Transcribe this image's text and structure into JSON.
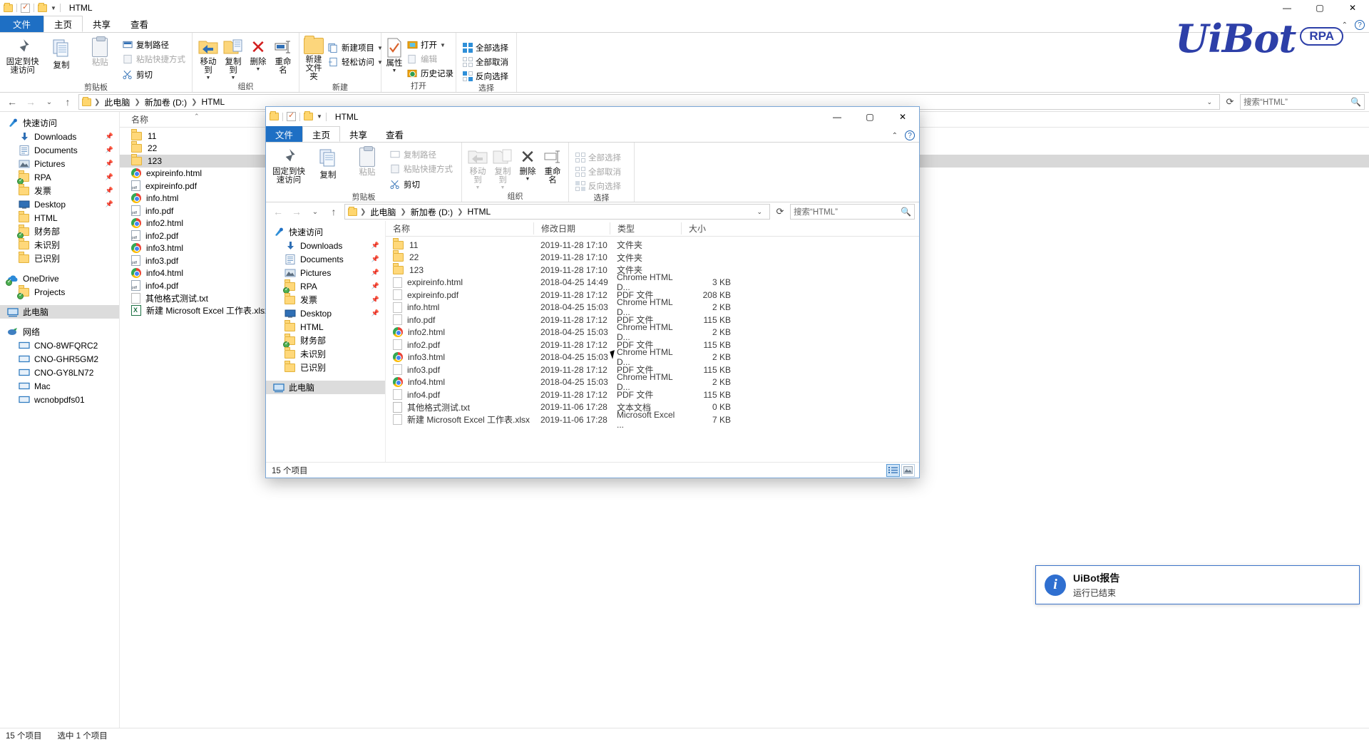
{
  "outer_window": {
    "title": "HTML",
    "quick_access_icons": [
      "folder-icon",
      "check-document-icon",
      "folder-icon",
      "chevron-down-icon"
    ],
    "window_controls": {
      "minimize": "—",
      "maximize": "▢",
      "close": "✕"
    },
    "tabs": [
      {
        "label": "文件",
        "active": false,
        "is_file_tab": true
      },
      {
        "label": "主页",
        "active": true
      },
      {
        "label": "共享",
        "active": false
      },
      {
        "label": "查看",
        "active": false
      }
    ],
    "ribbon": {
      "groups": [
        {
          "title": "剪贴板",
          "big_buttons": [
            {
              "label": "固定到快\n速访问",
              "icon": "pin-icon",
              "line1": "固定到快",
              "line2": "速访问"
            },
            {
              "label": "复制",
              "icon": "copy-icon"
            },
            {
              "label": "粘贴",
              "icon": "paste-icon",
              "dim": true
            }
          ],
          "small_buttons": [
            {
              "label": "复制路径",
              "icon": "copy-path-icon",
              "dim": false
            },
            {
              "label": "粘贴快捷方式",
              "icon": "paste-shortcut-icon",
              "dim": true
            },
            {
              "label": "剪切",
              "icon": "scissors-icon",
              "dim": false
            }
          ]
        },
        {
          "title": "组织",
          "big_buttons": [
            {
              "label": "移动到",
              "icon": "move-to-icon",
              "has_dropdown": true
            },
            {
              "label": "复制到",
              "icon": "copy-to-icon",
              "has_dropdown": true
            },
            {
              "label": "删除",
              "icon": "delete-icon",
              "has_dropdown": true
            },
            {
              "label": "重命名",
              "icon": "rename-icon"
            }
          ]
        },
        {
          "title": "新建",
          "big_buttons": [
            {
              "label": "新建\n文件夹",
              "icon": "new-folder-icon",
              "line1": "新建",
              "line2": "文件夹"
            }
          ],
          "small_buttons": [
            {
              "label": "新建项目",
              "icon": "new-item-icon",
              "has_dropdown": true
            },
            {
              "label": "轻松访问",
              "icon": "easy-access-icon",
              "has_dropdown": true
            }
          ]
        },
        {
          "title": "打开",
          "big_buttons": [
            {
              "label": "属性",
              "icon": "properties-icon",
              "has_dropdown": true
            }
          ],
          "small_buttons": [
            {
              "label": "打开",
              "icon": "open-icon",
              "has_dropdown": true
            },
            {
              "label": "编辑",
              "icon": "edit-icon",
              "dim": true
            },
            {
              "label": "历史记录",
              "icon": "history-icon"
            }
          ]
        },
        {
          "title": "选择",
          "small_buttons": [
            {
              "label": "全部选择",
              "icon": "select-all-icon"
            },
            {
              "label": "全部取消",
              "icon": "select-none-icon"
            },
            {
              "label": "反向选择",
              "icon": "invert-selection-icon"
            }
          ]
        }
      ]
    },
    "addressbar": {
      "back": "←",
      "forward": "→",
      "recent": "⌄",
      "up": "↑",
      "crumbs": [
        "此电脑",
        "新加卷 (D:)",
        "HTML"
      ],
      "search_value": "搜索“HTML”",
      "refresh_icon": "refresh-icon"
    },
    "navpane": [
      {
        "label": "快速访问",
        "icon": "star-pin-icon",
        "indent": 0,
        "pinned": false
      },
      {
        "label": "Downloads",
        "icon": "download-icon",
        "indent": 1,
        "pinned": true
      },
      {
        "label": "Documents",
        "icon": "documents-icon",
        "indent": 1,
        "pinned": true
      },
      {
        "label": "Pictures",
        "icon": "pictures-icon",
        "indent": 1,
        "pinned": true
      },
      {
        "label": "RPA",
        "icon": "folder-sync-icon",
        "indent": 1,
        "pinned": true
      },
      {
        "label": "发票",
        "icon": "folder-icon",
        "indent": 1,
        "pinned": true
      },
      {
        "label": "Desktop",
        "icon": "desktop-icon",
        "indent": 1,
        "pinned": true
      },
      {
        "label": "HTML",
        "icon": "folder-icon",
        "indent": 1,
        "pinned": false
      },
      {
        "label": "财务部",
        "icon": "folder-sync-icon",
        "indent": 1,
        "pinned": false
      },
      {
        "label": "未识别",
        "icon": "folder-icon",
        "indent": 1,
        "pinned": false
      },
      {
        "label": "已识别",
        "icon": "folder-icon",
        "indent": 1,
        "pinned": false
      },
      {
        "label": "OneDrive",
        "icon": "onedrive-icon",
        "indent": 0,
        "pinned": false,
        "gap_before": true
      },
      {
        "label": "Projects",
        "icon": "folder-sync-icon",
        "indent": 1,
        "pinned": false
      },
      {
        "label": "此电脑",
        "icon": "this-pc-icon",
        "indent": 0,
        "pinned": false,
        "selected": true,
        "gap_before": true
      },
      {
        "label": "网络",
        "icon": "network-icon",
        "indent": 0,
        "pinned": false,
        "gap_before": true
      },
      {
        "label": "CNO-8WFQRC2",
        "icon": "pc-icon",
        "indent": 1,
        "pinned": false
      },
      {
        "label": "CNO-GHR5GM2",
        "icon": "pc-icon",
        "indent": 1,
        "pinned": false
      },
      {
        "label": "CNO-GY8LN72",
        "icon": "pc-icon",
        "indent": 1,
        "pinned": false
      },
      {
        "label": "Mac",
        "icon": "pc-icon",
        "indent": 1,
        "pinned": false
      },
      {
        "label": "wcnobpdfs01",
        "icon": "pc-icon",
        "indent": 1,
        "pinned": false
      }
    ],
    "column_header": {
      "name": "名称"
    },
    "files": [
      {
        "name": "11",
        "icon": "folder-icon"
      },
      {
        "name": "22",
        "icon": "folder-icon"
      },
      {
        "name": "123",
        "icon": "folder-icon",
        "selected": true
      },
      {
        "name": "expireinfo.html",
        "icon": "chrome-icon"
      },
      {
        "name": "expireinfo.pdf",
        "icon": "pdf-icon"
      },
      {
        "name": "info.html",
        "icon": "chrome-icon"
      },
      {
        "name": "info.pdf",
        "icon": "pdf-icon"
      },
      {
        "name": "info2.html",
        "icon": "chrome-icon"
      },
      {
        "name": "info2.pdf",
        "icon": "pdf-icon"
      },
      {
        "name": "info3.html",
        "icon": "chrome-icon"
      },
      {
        "name": "info3.pdf",
        "icon": "pdf-icon"
      },
      {
        "name": "info4.html",
        "icon": "chrome-icon"
      },
      {
        "name": "info4.pdf",
        "icon": "pdf-icon"
      },
      {
        "name": "其他格式测试.txt",
        "icon": "text-icon"
      },
      {
        "name": "新建 Microsoft Excel 工作表.xlsx",
        "icon": "excel-icon"
      }
    ],
    "statusbar": {
      "count": "15 个项目",
      "selection": "选中 1 个项目"
    }
  },
  "watermark": {
    "text": "UiBot",
    "badge": "RPA",
    "color": "#2d3fa8"
  },
  "inner_window": {
    "title": "HTML",
    "window_controls": {
      "minimize": "—",
      "maximize": "▢",
      "close": "✕"
    },
    "tabs": [
      {
        "label": "文件",
        "is_file_tab": true
      },
      {
        "label": "主页",
        "active": true
      },
      {
        "label": "共享"
      },
      {
        "label": "查看"
      }
    ],
    "ribbon": {
      "groups": [
        {
          "title": "剪贴板",
          "big_buttons": [
            {
              "line1": "固定到快",
              "line2": "速访问",
              "icon": "pin-icon"
            },
            {
              "label": "复制",
              "icon": "copy-icon"
            },
            {
              "label": "粘贴",
              "icon": "paste-icon",
              "dim": true
            }
          ],
          "small_buttons": [
            {
              "label": "复制路径",
              "icon": "copy-path-icon"
            },
            {
              "label": "粘贴快捷方式",
              "icon": "paste-shortcut-icon",
              "dim": true
            },
            {
              "label": "剪切",
              "icon": "scissors-icon"
            }
          ]
        },
        {
          "title": "组织",
          "big_buttons": [
            {
              "label": "移动到",
              "icon": "move-to-icon",
              "dim": true,
              "has_dropdown": true
            },
            {
              "label": "复制到",
              "icon": "copy-to-icon",
              "dim": true,
              "has_dropdown": true
            },
            {
              "label": "删除",
              "icon": "delete-icon",
              "has_dropdown": true
            },
            {
              "label": "重命名",
              "icon": "rename-icon"
            }
          ]
        },
        {
          "title": "选择",
          "small_buttons": [
            {
              "label": "全部选择",
              "icon": "select-all-icon",
              "dim": true
            },
            {
              "label": "全部取消",
              "icon": "select-none-icon",
              "dim": true
            },
            {
              "label": "反向选择",
              "icon": "invert-selection-icon",
              "dim": true
            }
          ]
        }
      ]
    },
    "addressbar": {
      "back": "←",
      "forward": "→",
      "recent": "⌄",
      "up": "↑",
      "crumbs": [
        "此电脑",
        "新加卷 (D:)",
        "HTML"
      ],
      "search_value": "搜索“HTML”"
    },
    "navpane": [
      {
        "label": "快速访问",
        "icon": "star-pin-icon",
        "indent": 0
      },
      {
        "label": "Downloads",
        "icon": "download-icon",
        "indent": 1,
        "pinned": true
      },
      {
        "label": "Documents",
        "icon": "documents-icon",
        "indent": 1,
        "pinned": true
      },
      {
        "label": "Pictures",
        "icon": "pictures-icon",
        "indent": 1,
        "pinned": true
      },
      {
        "label": "RPA",
        "icon": "folder-sync-icon",
        "indent": 1,
        "pinned": true
      },
      {
        "label": "发票",
        "icon": "folder-icon",
        "indent": 1,
        "pinned": true
      },
      {
        "label": "Desktop",
        "icon": "desktop-icon",
        "indent": 1,
        "pinned": true
      },
      {
        "label": "HTML",
        "icon": "folder-icon",
        "indent": 1
      },
      {
        "label": "财务部",
        "icon": "folder-sync-icon",
        "indent": 1
      },
      {
        "label": "未识别",
        "icon": "folder-icon",
        "indent": 1
      },
      {
        "label": "已识别",
        "icon": "folder-icon",
        "indent": 1
      },
      {
        "label": "此电脑",
        "icon": "this-pc-icon",
        "indent": 0,
        "selected": true,
        "gap_before": true
      }
    ],
    "columns": [
      "名称",
      "修改日期",
      "类型",
      "大小"
    ],
    "rows": [
      {
        "name": "11",
        "icon": "folder-icon",
        "date": "2019-11-28 17:10",
        "type": "文件夹",
        "size": ""
      },
      {
        "name": "22",
        "icon": "folder-icon",
        "date": "2019-11-28 17:10",
        "type": "文件夹",
        "size": ""
      },
      {
        "name": "123",
        "icon": "folder-icon",
        "date": "2019-11-28 17:10",
        "type": "文件夹",
        "size": ""
      },
      {
        "name": "expireinfo.html",
        "icon": "blank-doc-icon",
        "date": "2018-04-25 14:49",
        "type": "Chrome HTML D...",
        "size": "3 KB"
      },
      {
        "name": "expireinfo.pdf",
        "icon": "blank-doc-icon",
        "date": "2019-11-28 17:12",
        "type": "PDF 文件",
        "size": "208 KB"
      },
      {
        "name": "info.html",
        "icon": "blank-doc-icon",
        "date": "2018-04-25 15:03",
        "type": "Chrome HTML D...",
        "size": "2 KB"
      },
      {
        "name": "info.pdf",
        "icon": "blank-doc-icon",
        "date": "2019-11-28 17:12",
        "type": "PDF 文件",
        "size": "115 KB"
      },
      {
        "name": "info2.html",
        "icon": "chrome-icon",
        "date": "2018-04-25 15:03",
        "type": "Chrome HTML D...",
        "size": "2 KB"
      },
      {
        "name": "info2.pdf",
        "icon": "blank-doc-icon",
        "date": "2019-11-28 17:12",
        "type": "PDF 文件",
        "size": "115 KB"
      },
      {
        "name": "info3.html",
        "icon": "chrome-icon",
        "date": "2018-04-25 15:03",
        "type": "Chrome HTML D...",
        "size": "2 KB"
      },
      {
        "name": "info3.pdf",
        "icon": "blank-doc-icon",
        "date": "2019-11-28 17:12",
        "type": "PDF 文件",
        "size": "115 KB"
      },
      {
        "name": "info4.html",
        "icon": "chrome-icon",
        "date": "2018-04-25 15:03",
        "type": "Chrome HTML D...",
        "size": "2 KB"
      },
      {
        "name": "info4.pdf",
        "icon": "blank-doc-icon",
        "date": "2019-11-28 17:12",
        "type": "PDF 文件",
        "size": "115 KB"
      },
      {
        "name": "其他格式测试.txt",
        "icon": "text-icon",
        "date": "2019-11-06 17:28",
        "type": "文本文档",
        "size": "0 KB"
      },
      {
        "name": "新建 Microsoft Excel 工作表.xlsx",
        "icon": "blank-doc-icon",
        "date": "2019-11-06 17:28",
        "type": "Microsoft Excel ...",
        "size": "7 KB"
      }
    ],
    "statusbar": {
      "count": "15 个项目"
    },
    "view_buttons": [
      "details-view-icon",
      "large-icons-view-icon"
    ]
  },
  "toast": {
    "title": "UiBot报告",
    "message": "运行已结束",
    "icon": "info-icon",
    "accent": "#2f6fd0"
  }
}
